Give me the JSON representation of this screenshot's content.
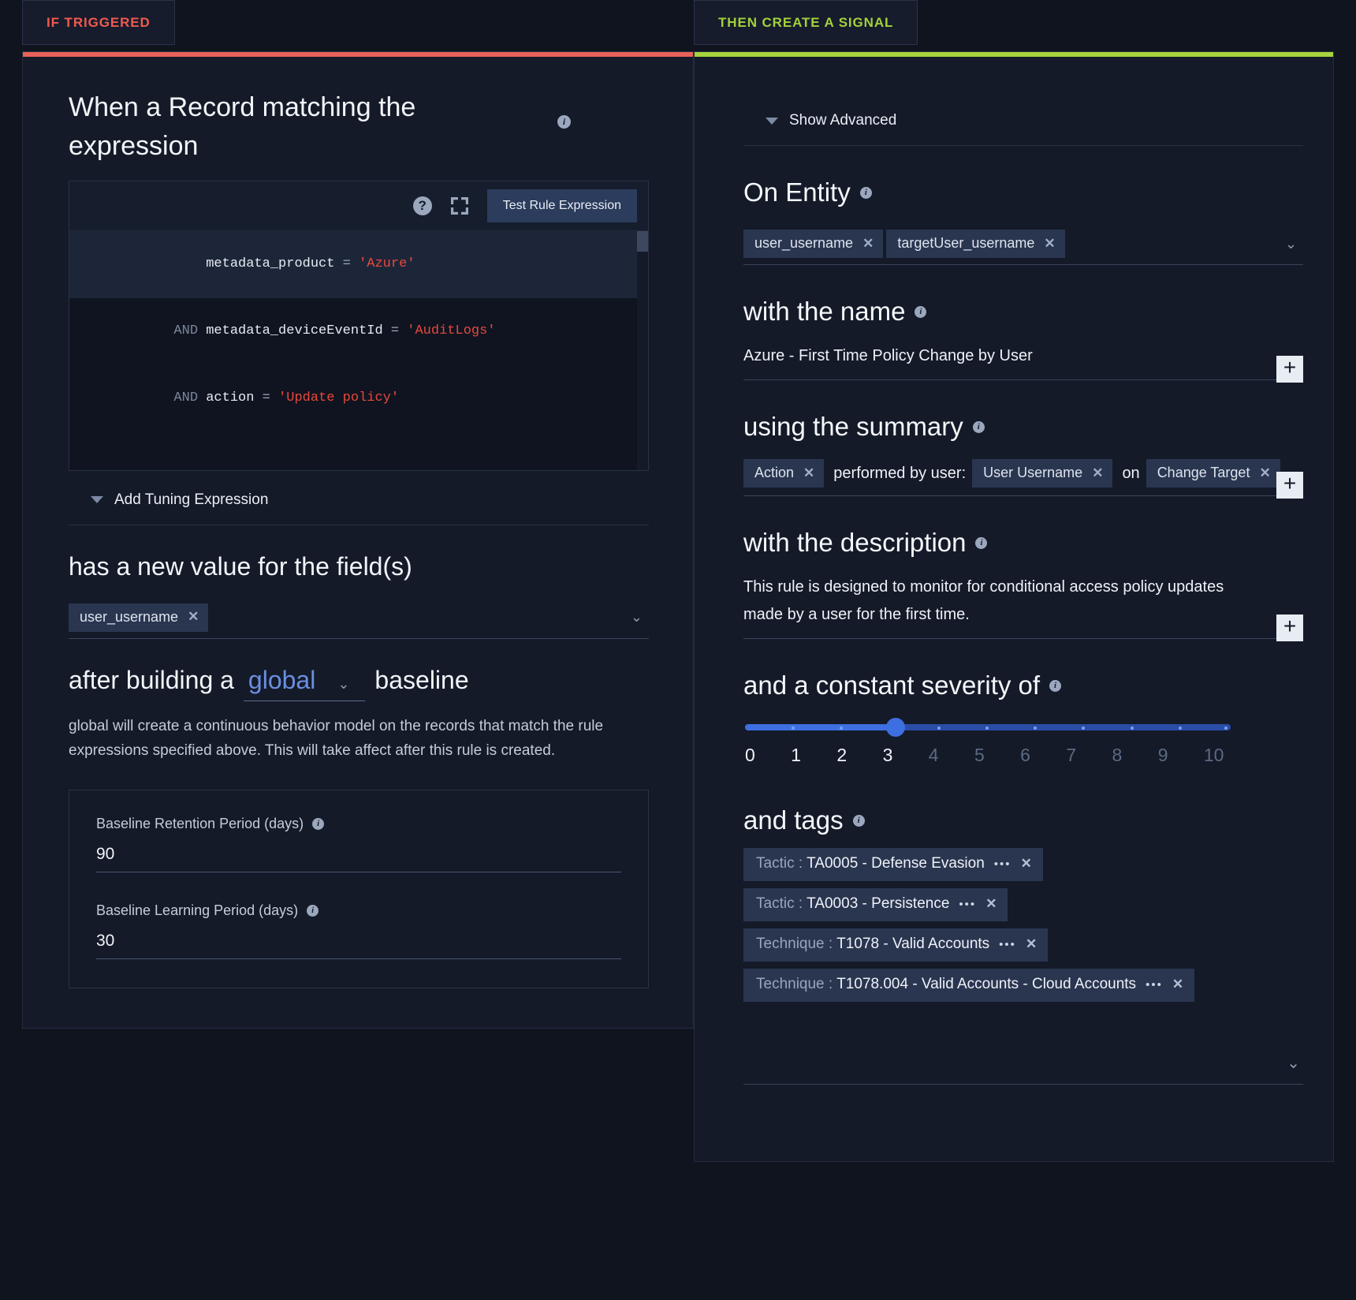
{
  "left": {
    "tab_label": "IF TRIGGERED",
    "accent": "#e8625a",
    "heading": "When a Record matching the expression",
    "editor": {
      "test_button": "Test Rule Expression",
      "help_icon": "?",
      "expand_icon": "expand-icon",
      "lines": [
        {
          "kw": "",
          "ident": "metadata_product",
          "op": "=",
          "str": "'Azure'"
        },
        {
          "kw": "AND",
          "ident": "metadata_deviceEventId",
          "op": "=",
          "str": "'AuditLogs'"
        },
        {
          "kw": "AND",
          "ident": "action",
          "op": "=",
          "str": "'Update policy'"
        }
      ]
    },
    "tuning_label": "Add Tuning Expression",
    "fields_heading": "has a new value for the field(s)",
    "field_chips": [
      "user_username"
    ],
    "baseline_prefix": "after building a",
    "baseline_value": "global",
    "baseline_suffix": "baseline",
    "baseline_note": "global will create a continuous behavior model on the records that match the rule expressions specified above. This will take affect after this rule is created.",
    "retention_label": "Baseline Retention Period (days)",
    "retention_value": "90",
    "learning_label": "Baseline Learning Period (days)",
    "learning_value": "30"
  },
  "right": {
    "tab_label": "THEN CREATE A SIGNAL",
    "accent": "#a6d43d",
    "show_advanced": "Show Advanced",
    "entity_heading": "On Entity",
    "entity_chips": [
      "user_username",
      "targetUser_username"
    ],
    "name_heading": "with the name",
    "name_value": "Azure - First Time Policy Change by User",
    "summary_heading": "using the summary",
    "summary_parts": [
      {
        "type": "chip",
        "text": "Action"
      },
      {
        "type": "text",
        "text": "performed by user:"
      },
      {
        "type": "chip",
        "text": "User Username"
      },
      {
        "type": "text",
        "text": "on"
      },
      {
        "type": "chip",
        "text": "Change Target"
      }
    ],
    "description_heading": "with the description",
    "description_value": "This rule is designed to monitor for conditional access policy updates made by a user for the first time.",
    "severity_heading": "and a constant severity of",
    "severity_value": 3,
    "severity_scale": [
      "0",
      "1",
      "2",
      "3",
      "4",
      "5",
      "6",
      "7",
      "8",
      "9",
      "10"
    ],
    "tags_heading": "and tags",
    "tags": [
      {
        "key": "Tactic :",
        "value": "TA0005 - Defense Evasion"
      },
      {
        "key": "Tactic :",
        "value": "TA0003 - Persistence"
      },
      {
        "key": "Technique :",
        "value": "T1078 - Valid Accounts"
      },
      {
        "key": "Technique :",
        "value": "T1078.004 - Valid Accounts - Cloud Accounts"
      }
    ],
    "plus_label": "+",
    "chevron_down": "⌄",
    "dots": "•••"
  }
}
